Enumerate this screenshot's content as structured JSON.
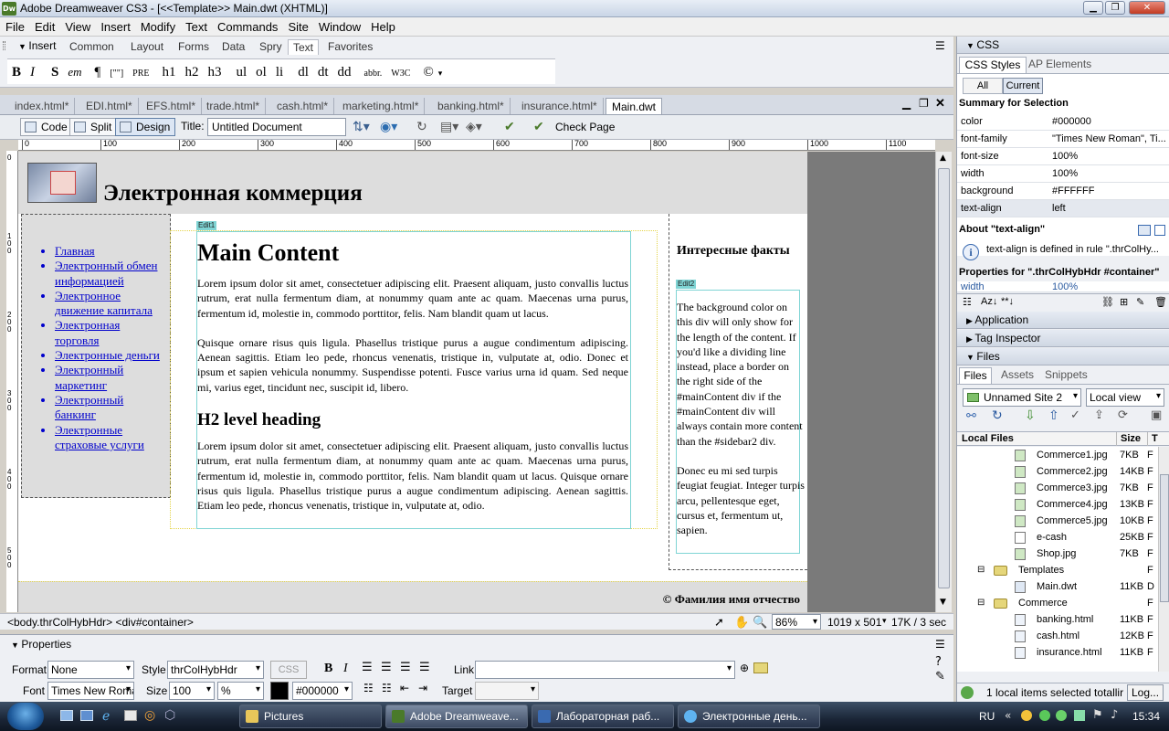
{
  "window": {
    "app_icon": "Dw",
    "title": "Adobe Dreamweaver CS3 - [<<Template>> Main.dwt (XHTML)]"
  },
  "menu": [
    "File",
    "Edit",
    "View",
    "Insert",
    "Modify",
    "Text",
    "Commands",
    "Site",
    "Window",
    "Help"
  ],
  "insert_bar": {
    "label": "Insert",
    "tabs": [
      "Common",
      "Layout",
      "Forms",
      "Data",
      "Spry",
      "Text",
      "Favorites"
    ],
    "active_tab": "Text",
    "icons": [
      "B",
      "I",
      "S",
      "em",
      "¶",
      "[\"\"]",
      "PRE",
      "h1",
      "h2",
      "h3",
      "ul",
      "ol",
      "li",
      "dl",
      "dt",
      "dd",
      "abbr.",
      "W3C",
      "©"
    ]
  },
  "doc_tabs": [
    "index.html*",
    "EDI.html*",
    "EFS.html*",
    "trade.html*",
    "cash.html*",
    "marketing.html*",
    "banking.html*",
    "insurance.html*",
    "Main.dwt"
  ],
  "doc_toolbar": {
    "code": "Code",
    "split": "Split",
    "design": "Design",
    "title_label": "Title:",
    "title_value": "Untitled Document",
    "check_page": "Check Page"
  },
  "ruler_marks": [
    "0",
    "100",
    "200",
    "300",
    "400",
    "500",
    "600",
    "700",
    "800",
    "900",
    "1000",
    "1100"
  ],
  "vruler_marks": [
    "0",
    "100",
    "200",
    "300",
    "400",
    "500"
  ],
  "page": {
    "site_title": "Электронная коммерция",
    "nav": [
      "Главная",
      "Электронный обмен информацией",
      "Электронное движение капитала",
      "Электронная торговля",
      "Электронные деньги",
      "Электронный маркетинг",
      "Электронный банкинг",
      "Электронные страховые услуги"
    ],
    "edit1": "Edit1",
    "main_heading": "Main Content",
    "p1": "Lorem ipsum dolor sit amet, consectetuer adipiscing elit. Praesent aliquam, justo convallis luctus rutrum, erat nulla fermentum diam, at nonummy quam ante ac quam. Maecenas urna purus, fermentum id, molestie in, commodo porttitor, felis. Nam blandit quam ut lacus.",
    "p2": "Quisque ornare risus quis ligula. Phasellus tristique purus a augue condimentum adipiscing. Aenean sagittis. Etiam leo pede, rhoncus venenatis, tristique in, vulputate at, odio. Donec et ipsum et sapien vehicula nonummy. Suspendisse potenti. Fusce varius urna id quam. Sed neque mi, varius eget, tincidunt nec, suscipit id, libero.",
    "h2": "H2 level heading",
    "p3": "Lorem ipsum dolor sit amet, consectetuer adipiscing elit. Praesent aliquam, justo convallis luctus rutrum, erat nulla fermentum diam, at nonummy quam ante ac quam. Maecenas urna purus, fermentum id, molestie in, commodo porttitor, felis. Nam blandit quam ut lacus. Quisque ornare risus quis ligula. Phasellus tristique purus a augue condimentum adipiscing. Aenean sagittis. Etiam leo pede, rhoncus venenatis, tristique in, vulputate at, odio.",
    "sidebar2_title": "Интересные факты",
    "edit2": "Edit2",
    "sb2_p1": "The background color on this div will only show for the length of the content. If you'd like a dividing line instead, place a border on the right side of the #mainContent div if the #mainContent div will always contain more content than the #sidebar2 div.",
    "sb2_p2": "Donec eu mi sed turpis feugiat feugiat. Integer turpis arcu, pellentesque eget, cursus et, fermentum ut, sapien.",
    "footer": "© Фамилия имя отчество"
  },
  "status_bar": {
    "tags": "<body.thrColHybHdr> <div#container>",
    "zoom": "86%",
    "size": "1019 x 501",
    "weight": "17K / 3 sec"
  },
  "properties": {
    "header": "Properties",
    "format_label": "Format",
    "format": "None",
    "style_label": "Style",
    "style": "thrColHybHdr",
    "css_btn": "CSS",
    "link_label": "Link",
    "font_label": "Font",
    "font": "Times New Roman",
    "size_label": "Size",
    "size": "100",
    "unit": "%",
    "color": "#000000",
    "target_label": "Target"
  },
  "css_panel": {
    "title": "CSS",
    "tabs": [
      "CSS Styles",
      "AP Elements"
    ],
    "modes": [
      "All",
      "Current"
    ],
    "summary_title": "Summary for Selection",
    "props": [
      {
        "k": "color",
        "v": "#000000"
      },
      {
        "k": "font-family",
        "v": "\"Times New Roman\", Ti..."
      },
      {
        "k": "font-size",
        "v": "100%"
      },
      {
        "k": "width",
        "v": "100%"
      },
      {
        "k": "background",
        "v": "#FFFFFF"
      },
      {
        "k": "text-align",
        "v": "left"
      }
    ],
    "about_title": "About \"text-align\"",
    "about_text": "text-align is defined in rule \".thrColHy...",
    "props_for": "Properties for \".thrColHybHdr #container\"",
    "props_for_row": {
      "k": "width",
      "v": "100%"
    }
  },
  "application": "Application",
  "tag_inspector": "Tag Inspector",
  "files_panel": {
    "title": "Files",
    "tabs": [
      "Files",
      "Assets",
      "Snippets"
    ],
    "site": "Unnamed Site 2",
    "view": "Local view",
    "col_name": "Local Files",
    "col_size": "Size",
    "col_type": "T",
    "rows": [
      {
        "name": "Commerce1.jpg",
        "size": "7KB",
        "type": "F"
      },
      {
        "name": "Commerce2.jpg",
        "size": "14KB",
        "type": "F"
      },
      {
        "name": "Commerce3.jpg",
        "size": "7KB",
        "type": "F"
      },
      {
        "name": "Commerce4.jpg",
        "size": "13KB",
        "type": "F"
      },
      {
        "name": "Commerce5.jpg",
        "size": "10KB",
        "type": "F"
      },
      {
        "name": "e-cash",
        "size": "25KB",
        "type": "F"
      },
      {
        "name": "Shop.jpg",
        "size": "7KB",
        "type": "F"
      },
      {
        "name": "Templates",
        "size": "",
        "type": "F"
      },
      {
        "name": "Main.dwt",
        "size": "11KB",
        "type": "D"
      },
      {
        "name": "Commerce",
        "size": "",
        "type": "F"
      },
      {
        "name": "banking.html",
        "size": "11KB",
        "type": "F"
      },
      {
        "name": "cash.html",
        "size": "12KB",
        "type": "F"
      },
      {
        "name": "insurance.html",
        "size": "11KB",
        "type": "F"
      }
    ],
    "status": "1 local items selected totallir",
    "log_btn": "Log..."
  },
  "taskbar": {
    "buttons": [
      "Pictures",
      "Adobe Dreamweave...",
      "Лабораторная раб...",
      "Электронные день..."
    ],
    "lang": "RU",
    "time": "15:34"
  },
  "colors": {
    "accent": "#7fd4d4",
    "link": "#0000cc",
    "header_bg": "#dddddd"
  }
}
